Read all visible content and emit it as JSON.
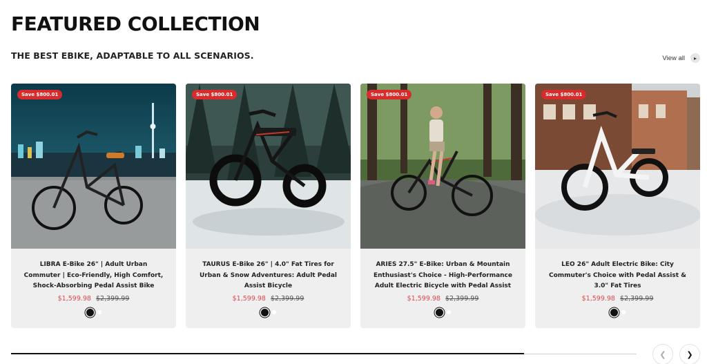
{
  "section": {
    "title": "FEATURED COLLECTION",
    "subtitle": "THE BEST EBIKE, ADAPTABLE TO ALL SCENARIOS.",
    "view_all": "View all",
    "view_all_icon": "chevron-right-icon"
  },
  "products": [
    {
      "badge": "Save $800.01",
      "title": "LIBRA E-Bike 26\" | Adult Urban Commuter | Eco-Friendly, High Comfort, Shock-Absorbing Pedal Assist Bike",
      "price": "$1,599.98",
      "compare_price": "$2,399.99",
      "swatches": [
        "black",
        "white"
      ],
      "scene": "night city waterfront"
    },
    {
      "badge": "Save $800.01",
      "title": "TAURUS E-Bike 26\" | 4.0\" Fat Tires for Urban & Snow Adventures: Adult Pedal Assist Bicycle",
      "price": "$1,599.98",
      "compare_price": "$2,399.99",
      "swatches": [
        "black",
        "white"
      ],
      "scene": "snowy forest"
    },
    {
      "badge": "Save $800.01",
      "title": "ARIES 27.5\" E-Bike: Urban & Mountain Enthusiast's Choice - High-Performance Adult Electric Bicycle with Pedal Assist",
      "price": "$1,599.98",
      "compare_price": "$2,399.99",
      "swatches": [
        "black",
        "white"
      ],
      "scene": "forest trail with rider"
    },
    {
      "badge": "Save $800.01",
      "title": "LEO 26\" Adult Electric Bike: City Commuter's Choice with Pedal Assist & 3.0\" Fat Tires",
      "price": "$1,599.98",
      "compare_price": "$2,399.99",
      "swatches": [
        "black",
        "white"
      ],
      "scene": "snowy town street"
    }
  ],
  "carousel": {
    "progress": 0.82,
    "prev_icon": "chevron-left-icon",
    "next_icon": "chevron-right-icon"
  },
  "colors": {
    "sale_price": "#e0474c",
    "badge": "#d92b2b",
    "card_bg": "#efefef"
  }
}
